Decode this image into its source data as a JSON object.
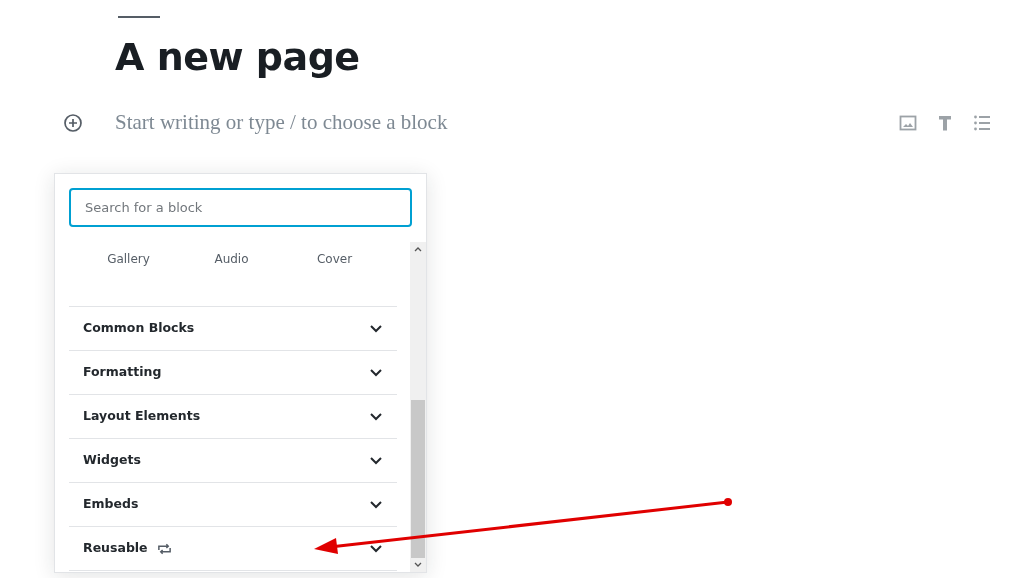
{
  "page_title": "A new page",
  "block_placeholder": "Start writing or type / to choose a block",
  "inserter": {
    "search": {
      "placeholder": "Search for a block"
    },
    "recent_blocks": [
      "Gallery",
      "Audio",
      "Cover"
    ],
    "categories": [
      {
        "label": "Common Blocks",
        "kind": "plain",
        "expanded": false
      },
      {
        "label": "Formatting",
        "kind": "plain",
        "expanded": false
      },
      {
        "label": "Layout Elements",
        "kind": "plain",
        "expanded": false
      },
      {
        "label": "Widgets",
        "kind": "plain",
        "expanded": false
      },
      {
        "label": "Embeds",
        "kind": "plain",
        "expanded": false
      },
      {
        "label": "Reusable",
        "kind": "reusable",
        "expanded": false
      }
    ]
  }
}
